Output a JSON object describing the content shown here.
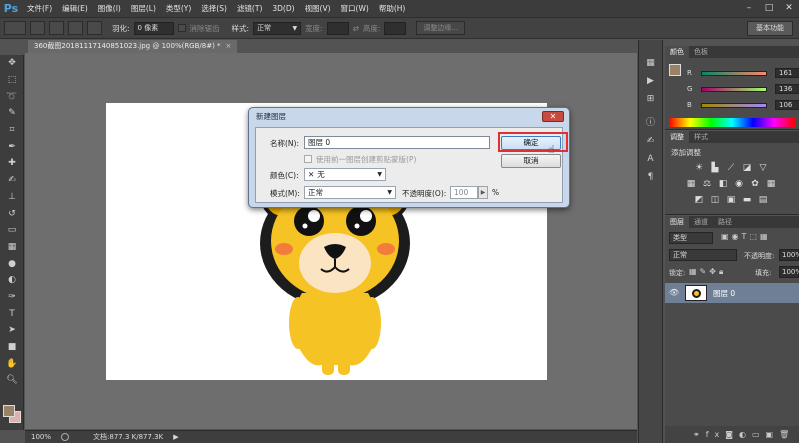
{
  "app": {
    "logo": "Ps"
  },
  "menu": [
    "文件(F)",
    "编辑(E)",
    "图像(I)",
    "图层(L)",
    "类型(Y)",
    "选择(S)",
    "滤镜(T)",
    "3D(D)",
    "视图(V)",
    "窗口(W)",
    "帮助(H)"
  ],
  "window_controls": [
    "–",
    "□",
    "✕"
  ],
  "options": {
    "feather_label": "羽化:",
    "feather_value": "0 像素",
    "antialias_label": "消除锯齿",
    "style_label": "样式:",
    "style_value": "正常",
    "width_label": "宽度:",
    "height_label": "高度:",
    "refine_edge": "调整边缘...",
    "workspace": "基本功能"
  },
  "document": {
    "tab_title": "360截图20181117140851023.jpg @ 100%(RGB/8#) *",
    "close": "×"
  },
  "status": {
    "zoom": "100%",
    "doc_info": "文档:877.3 K/877.3K",
    "arrow": "▶"
  },
  "color_panel": {
    "tabs": [
      "颜色",
      "色板"
    ],
    "r_label": "R",
    "r_value": "161",
    "g_label": "G",
    "g_value": "136",
    "b_label": "B",
    "b_value": "106",
    "r": 161,
    "g": 136,
    "b": 106
  },
  "adjust_panel": {
    "tabs": [
      "调整",
      "样式"
    ],
    "title": "添加调整"
  },
  "layers_panel": {
    "tabs": [
      "图层",
      "通道",
      "路径"
    ],
    "kind_label": "类型",
    "blend_mode": "正常",
    "opacity_label": "不透明度:",
    "opacity_value": "100%",
    "lock_label": "锁定:",
    "fill_label": "填充:",
    "fill_value": "100%",
    "layer_name": "图层 0"
  },
  "dialog": {
    "title": "新建图层",
    "close": "✕",
    "name_label": "名称(N):",
    "name_value": "图层 0",
    "clip_label": "使用前一图层创建剪贴蒙版(P)",
    "color_label": "颜色(C):",
    "color_value": "无",
    "color_x": "✕",
    "mode_label": "模式(M):",
    "mode_value": "正常",
    "opacity_label": "不透明度(O):",
    "opacity_value": "100",
    "percent": "%",
    "ok": "确定",
    "cancel": "取消"
  },
  "colors": {
    "foreground": "#998265",
    "background": "#e0b0b0",
    "highlight": "#e03030",
    "accent": "#4fa3e0"
  }
}
